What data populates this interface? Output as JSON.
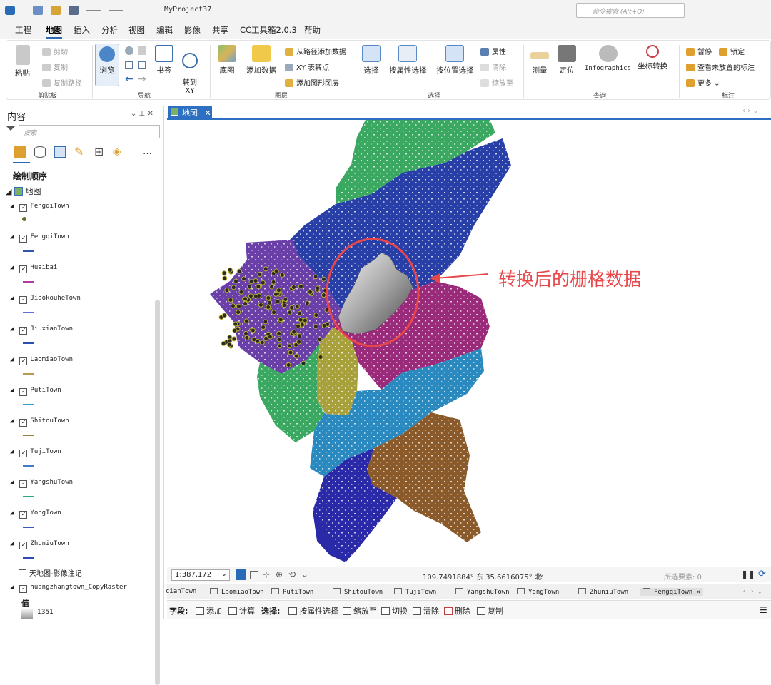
{
  "titlebar": {
    "project": "MyProject37",
    "search_placeholder": "命令搜索 (Alt+Q)"
  },
  "menu": [
    {
      "label": "工程"
    },
    {
      "label": "地图",
      "active": true
    },
    {
      "label": "插入"
    },
    {
      "label": "分析"
    },
    {
      "label": "视图"
    },
    {
      "label": "编辑"
    },
    {
      "label": "影像"
    },
    {
      "label": "共享"
    },
    {
      "label": "CC工具箱2.0.3"
    },
    {
      "label": "帮助"
    }
  ],
  "ribbon": {
    "clipboard": {
      "paste": "粘贴",
      "cut": "剪切",
      "copy": "复制",
      "copy_path": "复制路径",
      "group": "剪贴板"
    },
    "navigate": {
      "explore": "浏览",
      "bookmarks": "书签",
      "goto_xy": "转到\nXY",
      "group": "导航"
    },
    "layer": {
      "basemap": "底图",
      "add_data": "添加数据",
      "add_from_path": "从路径添加数据",
      "xy_to_point": "XY 表转点",
      "add_graphics_layer": "添加图形图层",
      "group": "图层"
    },
    "selection": {
      "select": "选择",
      "by_attr": "按属性选择",
      "by_loc": "按位置选择",
      "attributes": "属性",
      "clear": "清除",
      "zoom_to": "缩放至",
      "group": "选择"
    },
    "inquiry": {
      "measure": "测量",
      "locate": "定位",
      "infographics": "Infographics",
      "coord_convert": "坐标转换",
      "group": "查询"
    },
    "labeling": {
      "pause": "暂停",
      "lock": "锁定",
      "view_unplaced": "查看未放置的标注",
      "more": "更多",
      "group": "标注"
    }
  },
  "contents": {
    "title": "内容",
    "search_placeholder": "搜索",
    "draw_order": "绘制顺序",
    "map_name": "地图",
    "layers": [
      {
        "name": "FengqiTown",
        "symbol": "point",
        "color": "#6b6b2a"
      },
      {
        "name": "FengqiTown",
        "symbol": "line",
        "color": "#2f55a8"
      },
      {
        "name": "Huaibai",
        "symbol": "line",
        "color": "#b03aa0"
      },
      {
        "name": "JiaokouheTown",
        "symbol": "line",
        "color": "#5b6fd8"
      },
      {
        "name": "JiuxianTown",
        "symbol": "line",
        "color": "#2a4fb0"
      },
      {
        "name": "LaomiaoTown",
        "symbol": "line",
        "color": "#b79a4e"
      },
      {
        "name": "PutiTown",
        "symbol": "line",
        "color": "#3a9ad0"
      },
      {
        "name": "ShitouTown",
        "symbol": "line",
        "color": "#a07a3a"
      },
      {
        "name": "TujiTown",
        "symbol": "line",
        "color": "#3e7ec8"
      },
      {
        "name": "YangshuTown",
        "symbol": "line",
        "color": "#2bab7a"
      },
      {
        "name": "YongTown",
        "symbol": "line",
        "color": "#3a59c0"
      },
      {
        "name": "ZhuniuTown",
        "symbol": "line",
        "color": "#3049b8"
      }
    ],
    "tianditu": "天地图-影像注记",
    "raster": "huangzhangtown_CopyRaster",
    "value_label": "值",
    "value_high": "1351"
  },
  "map": {
    "tab": "地图",
    "annotation": "转换后的栅格数据",
    "scale": "1:387,172",
    "coords": "109.7491884° 东  35.6616075° 北",
    "selected": "所选要素: 0"
  },
  "table_tabs": [
    "cianTown",
    "LaomiaoTown",
    "PutiTown",
    "ShitouTown",
    "TujiTown",
    "YangshuTown",
    "YongTown",
    "ZhuniuTown",
    "FengqiTown"
  ],
  "bottom_toolbar": {
    "field_label": "字段:",
    "add": "添加",
    "calculate": "计算",
    "select_label": "选择:",
    "by_attr": "按属性选择",
    "zoom_to": "缩放至",
    "switch": "切换",
    "clear": "清除",
    "delete": "删除",
    "copy": "复制"
  },
  "colors": {
    "accent": "#2d6fc0",
    "annotation": "#e8474a"
  }
}
